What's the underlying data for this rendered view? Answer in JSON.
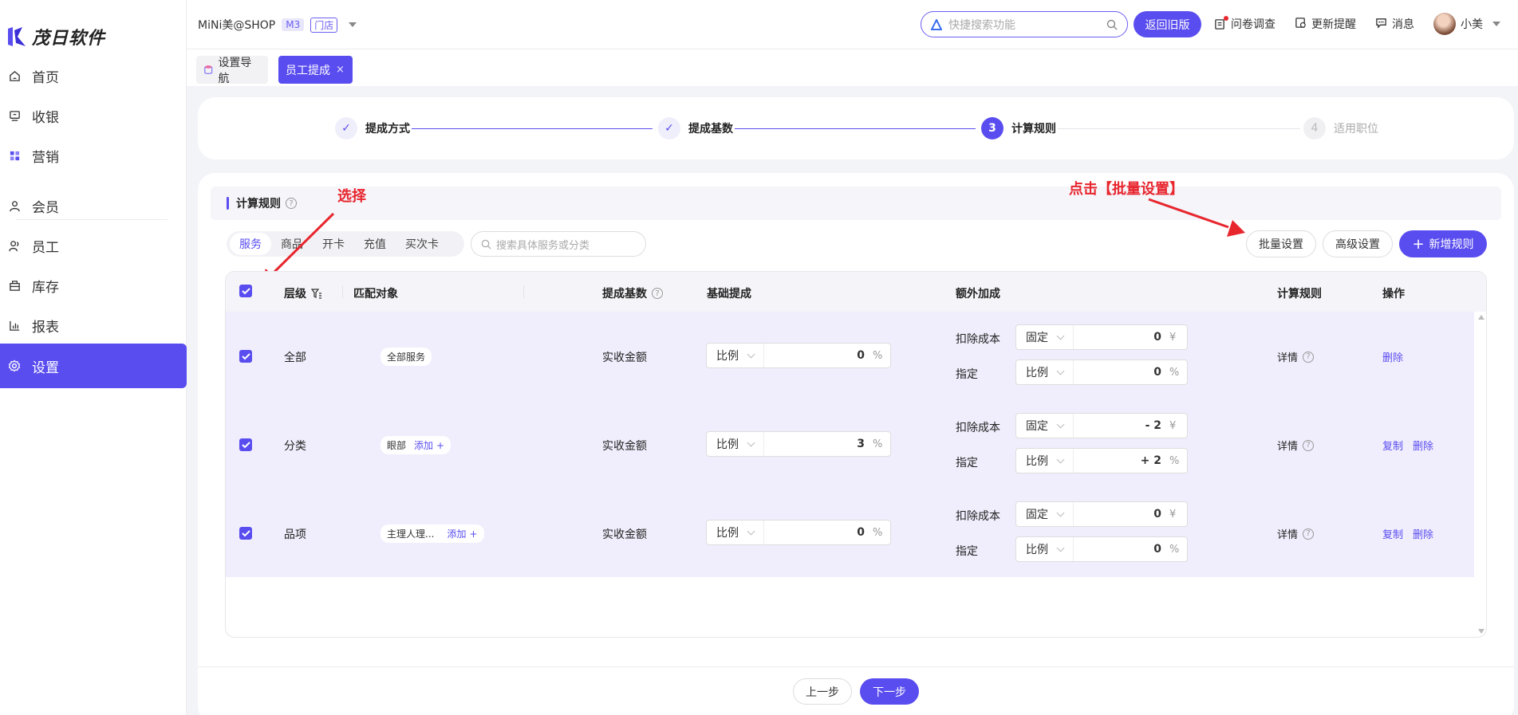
{
  "app": {
    "logo_text": "茂日软件"
  },
  "sidebar": {
    "items": [
      {
        "label": "首页",
        "icon": "home-icon"
      },
      {
        "label": "收银",
        "icon": "cashier-icon"
      },
      {
        "label": "营销",
        "icon": "marketing-icon"
      },
      {
        "label": "会员",
        "icon": "member-icon"
      },
      {
        "label": "员工",
        "icon": "staff-icon"
      },
      {
        "label": "库存",
        "icon": "inventory-icon"
      },
      {
        "label": "报表",
        "icon": "report-icon"
      },
      {
        "label": "设置",
        "icon": "gear-icon",
        "active": true
      }
    ]
  },
  "topbar": {
    "shop_name": "MiNi美@SHOP",
    "shop_tag": "M3",
    "store_tag": "门店",
    "search_placeholder": "快捷搜索功能",
    "old_version": "返回旧版",
    "survey": "问卷调查",
    "update": "更新提醒",
    "message": "消息",
    "user": "小美"
  },
  "tabs": [
    {
      "label": "设置导航"
    },
    {
      "label": "员工提成",
      "active": true,
      "close": "×"
    }
  ],
  "steps": [
    {
      "label": "提成方式",
      "state": "done",
      "mark": "✓"
    },
    {
      "label": "提成基数",
      "state": "done",
      "mark": "✓"
    },
    {
      "label": "计算规则",
      "state": "current",
      "mark": "3"
    },
    {
      "label": "适用职位",
      "state": "pending",
      "mark": "4"
    }
  ],
  "section": {
    "title": "计算规则",
    "help": "?"
  },
  "annotations": {
    "select": "选择",
    "batch": "点击【批量设置】"
  },
  "filters": {
    "segments": [
      "服务",
      "商品",
      "开卡",
      "充值",
      "买次卡"
    ],
    "active": "服务",
    "search_placeholder": "搜索具体服务或分类"
  },
  "actions": {
    "batch": "批量设置",
    "advanced": "高级设置",
    "add": "新增规则",
    "add_icon": "+"
  },
  "table": {
    "headers": {
      "level": "层级",
      "target": "匹配对象",
      "base": "提成基数",
      "basic": "基础提成",
      "extra": "额外加成",
      "rule": "计算规则",
      "op": "操作"
    },
    "rows": [
      {
        "level": "全部",
        "target": "全部服务",
        "add": "",
        "base": "实收金额",
        "basic": {
          "type": "比例",
          "value": "0",
          "unit": "%"
        },
        "extra": [
          {
            "label": "扣除成本",
            "type": "固定",
            "value": "0",
            "unit": "¥"
          },
          {
            "label": "指定",
            "type": "比例",
            "value": "0",
            "unit": "%"
          }
        ],
        "rule": "详情",
        "copy": "",
        "delete": "删除"
      },
      {
        "level": "分类",
        "target": "眼部",
        "add": "添加",
        "base": "实收金额",
        "basic": {
          "type": "比例",
          "value": "3",
          "unit": "%"
        },
        "extra": [
          {
            "label": "扣除成本",
            "type": "固定",
            "value": "- 2",
            "unit": "¥"
          },
          {
            "label": "指定",
            "type": "比例",
            "value": "+ 2",
            "unit": "%"
          }
        ],
        "rule": "详情",
        "copy": "复制",
        "delete": "删除"
      },
      {
        "level": "品项",
        "target": "主理人理...",
        "add": "添加",
        "base": "实收金额",
        "basic": {
          "type": "比例",
          "value": "0",
          "unit": "%"
        },
        "extra": [
          {
            "label": "扣除成本",
            "type": "固定",
            "value": "0",
            "unit": "¥"
          },
          {
            "label": "指定",
            "type": "比例",
            "value": "0",
            "unit": "%"
          }
        ],
        "rule": "详情",
        "copy": "复制",
        "delete": "删除"
      }
    ]
  },
  "footer": {
    "prev": "上一步",
    "next": "下一步"
  },
  "colors": {
    "accent": "#5a4df0",
    "annotation": "#e8262e",
    "row_bg": "#f0eefc"
  }
}
